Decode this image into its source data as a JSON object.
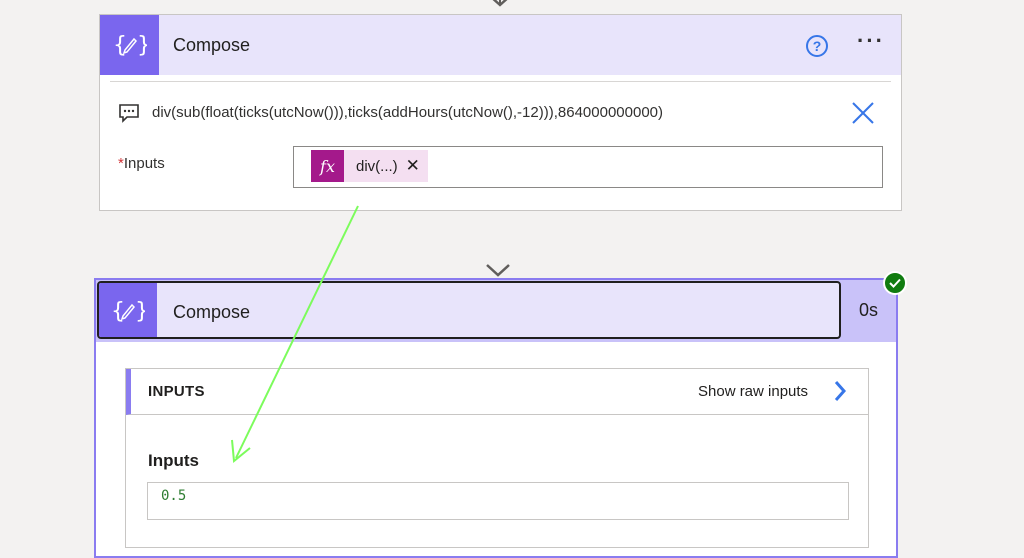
{
  "top_card": {
    "title": "Compose",
    "help_symbol": "?",
    "more_symbol": "···",
    "expression": "div(sub(float(ticks(utcNow())),ticks(addHours(utcNow(),-12))),864000000000)",
    "required_marker": "*",
    "inputs_label": "Inputs",
    "token_label": "div(...)",
    "token_remove": "✕"
  },
  "bottom_card": {
    "title": "Compose",
    "duration": "0s",
    "section_label": "INPUTS",
    "show_raw_label": "Show raw inputs",
    "field_label": "Inputs",
    "field_value": "0.5"
  },
  "icons": {
    "action_icon": "compose-braces-icon",
    "comment_icon": "comment-icon",
    "close_icon": "close-icon",
    "fx_icon": "fx-icon",
    "success_icon": "check-circle-icon",
    "arrow_color": "#7CFC5C"
  },
  "colors": {
    "header_bg": "#e8e4fb",
    "icon_bg": "#7a66ee",
    "fx_bg": "#a4198b",
    "link_blue": "#3776e8",
    "success_green": "#107c10"
  }
}
